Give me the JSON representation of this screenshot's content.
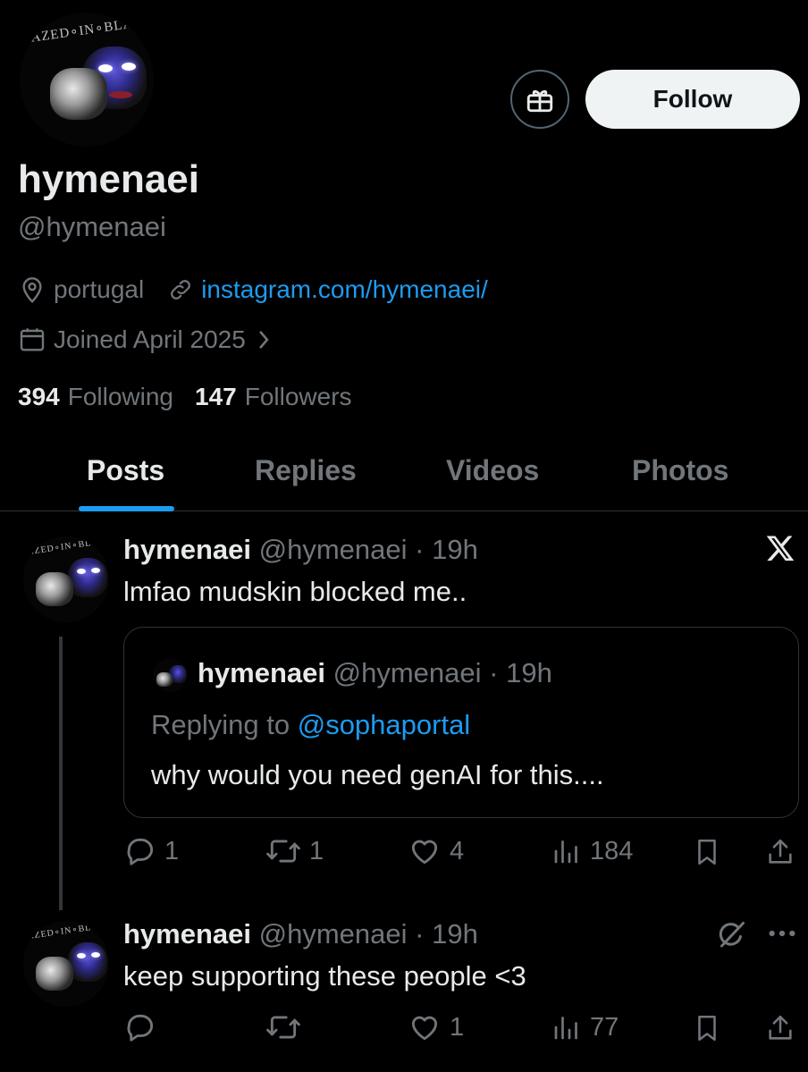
{
  "profile": {
    "avatar_text": "AZED∘IN∘BLAC",
    "display_name": "hymenaei",
    "handle": "@hymenaei",
    "location": "portugal",
    "website": "instagram.com/hymenaei/",
    "joined": "Joined April 2025",
    "following_count": "394",
    "following_label": "Following",
    "followers_count": "147",
    "followers_label": "Followers",
    "follow_button": "Follow"
  },
  "tabs": [
    {
      "label": "Posts",
      "active": true
    },
    {
      "label": "Replies",
      "active": false
    },
    {
      "label": "Videos",
      "active": false
    },
    {
      "label": "Photos",
      "active": false
    }
  ],
  "posts": [
    {
      "name": "hymenaei",
      "handle": "@hymenaei",
      "time": "19h",
      "text": "lmfao mudskin blocked me..",
      "quote": {
        "name": "hymenaei",
        "handle": "@hymenaei",
        "time": "19h",
        "replying_label": "Replying to",
        "replying_to": "@sophaportal",
        "text": "why would you need genAI for this...."
      },
      "replies": "1",
      "reposts": "1",
      "likes": "4",
      "views": "184"
    },
    {
      "name": "hymenaei",
      "handle": "@hymenaei",
      "time": "19h",
      "text": "keep supporting these people <3",
      "replies": "",
      "reposts": "",
      "likes": "1",
      "views": "77"
    }
  ],
  "colors": {
    "background": "#000000",
    "text_primary": "#e7e9ea",
    "text_secondary": "#71767b",
    "accent": "#1d9bf0",
    "border": "#2f3336"
  },
  "icons": [
    "gift-icon",
    "location-icon",
    "link-icon",
    "calendar-icon",
    "chevron-right-icon",
    "x-logo-icon",
    "grok-icon",
    "more-icon",
    "reply-icon",
    "repost-icon",
    "like-icon",
    "views-icon",
    "bookmark-icon",
    "share-icon"
  ]
}
